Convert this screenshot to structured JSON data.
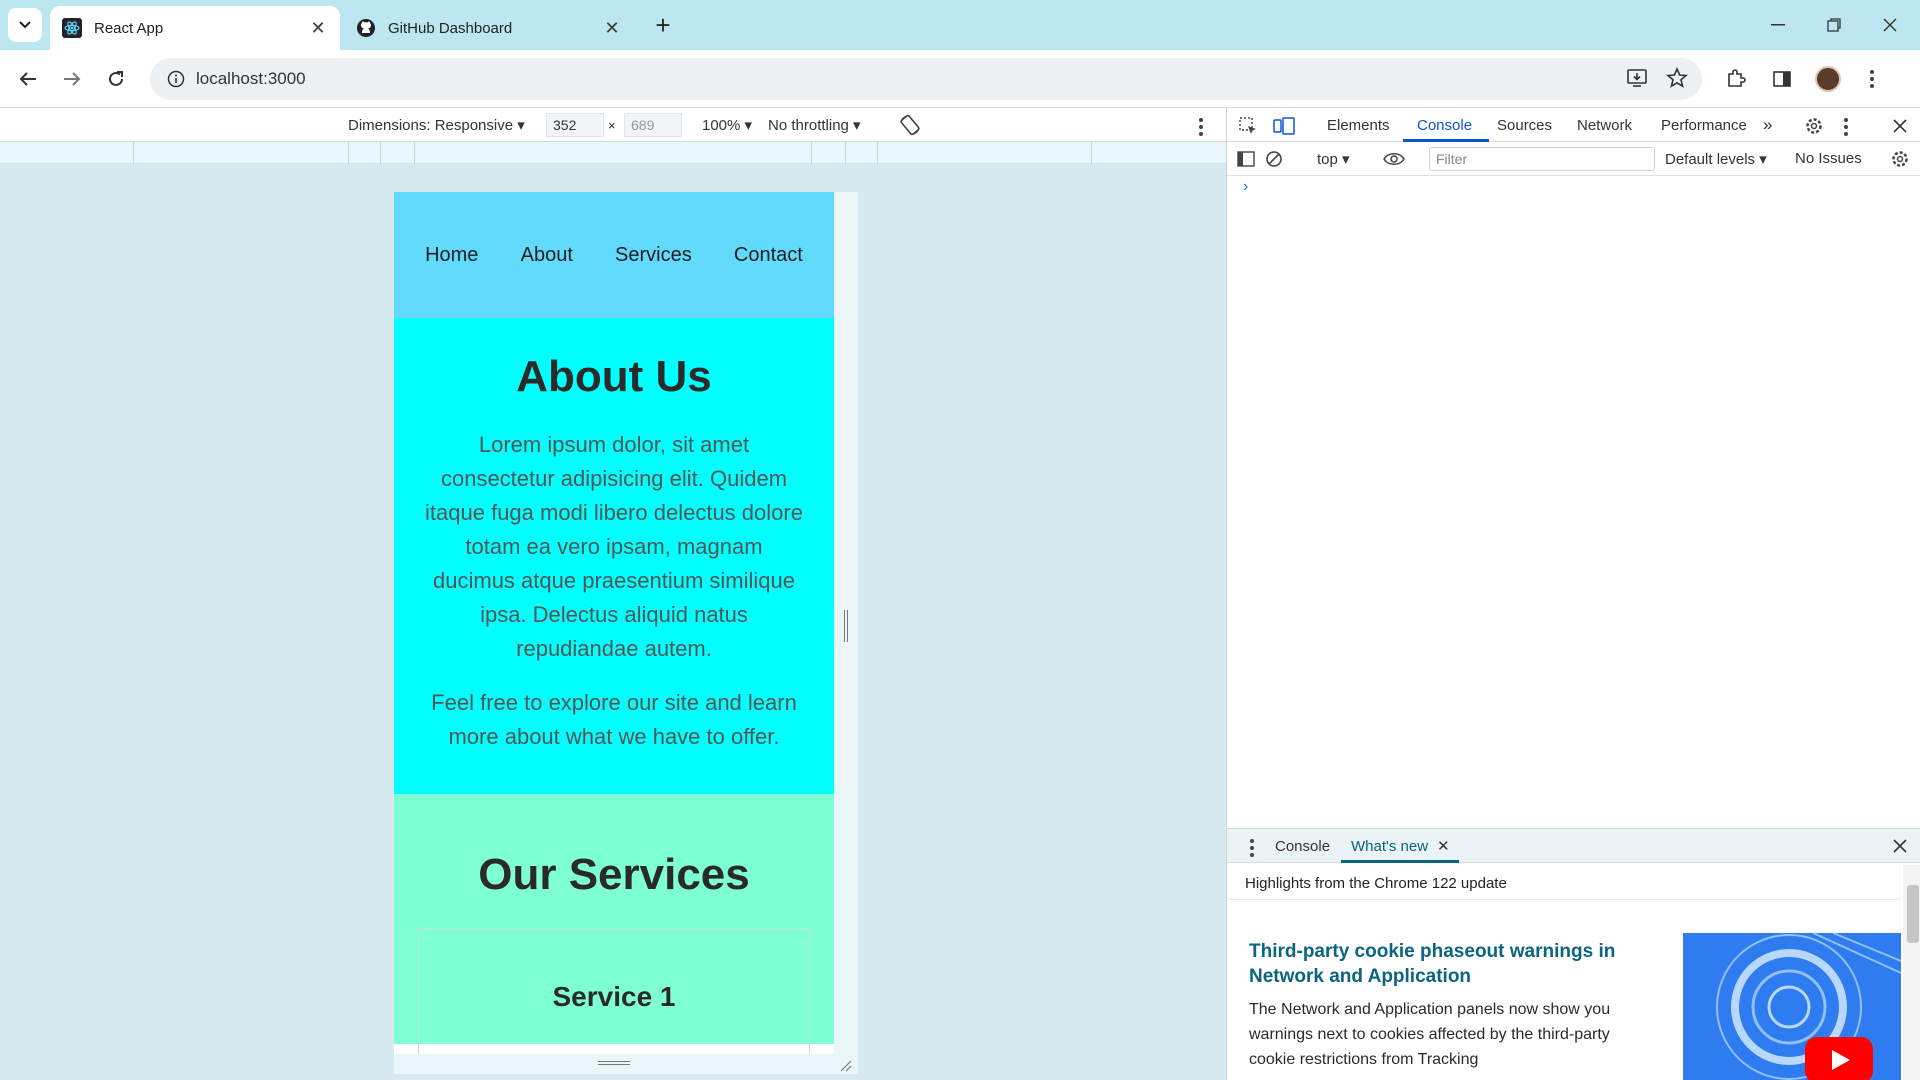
{
  "browser": {
    "tabs": [
      {
        "title": "React App",
        "active": true,
        "icon": "react-icon"
      },
      {
        "title": "GitHub Dashboard",
        "active": false,
        "icon": "github-icon"
      }
    ],
    "new_tab_label": "+",
    "address": "localhost:3000"
  },
  "device_toolbar": {
    "dimensions_label": "Dimensions: Responsive",
    "width": "352",
    "height": "689",
    "times": "×",
    "zoom": "100%",
    "throttling": "No throttling"
  },
  "page": {
    "nav": [
      "Home",
      "About",
      "Services",
      "Contact"
    ],
    "about": {
      "heading": "About Us",
      "paragraph1": "Lorem ipsum dolor, sit amet consectetur adipisicing elit. Quidem itaque fuga modi libero delectus dolore totam ea vero ipsam, magnam ducimus atque praesentium similique ipsa. Delectus aliquid natus repudiandae autem.",
      "paragraph2": "Feel free to explore our site and learn more about what we have to offer."
    },
    "services": {
      "heading": "Our Services",
      "card_title": "Service 1"
    },
    "colors": {
      "nav_bg": "#61dafb",
      "about_bg": "#00ffff",
      "services_bg": "#7fffd4"
    }
  },
  "devtools": {
    "tabs": [
      "Elements",
      "Console",
      "Sources",
      "Network",
      "Performance"
    ],
    "active_tab": "Console",
    "more_tabs": "»",
    "console_bar": {
      "context": "top",
      "filter_placeholder": "Filter",
      "levels": "Default levels",
      "issues": "No Issues"
    },
    "prompt": "›",
    "drawer": {
      "tabs": [
        "Console",
        "What's new"
      ],
      "active_tab": "What's new",
      "subtitle": "Highlights from the Chrome 122 update",
      "news_title": "Third-party cookie phaseout warnings in Network and Application",
      "news_body": "The Network and Application panels now show you warnings next to cookies affected by the third-party cookie restrictions from Tracking"
    },
    "accent": "#0b57d0"
  }
}
